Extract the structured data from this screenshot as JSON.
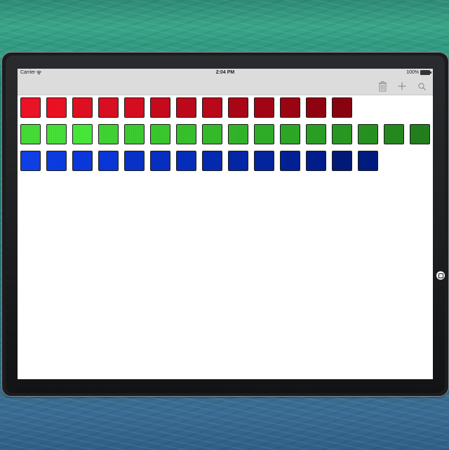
{
  "status_bar": {
    "carrier": "Carrier",
    "wifi_icon": "wifi-icon",
    "time": "2:04 PM",
    "battery": "100%",
    "battery_icon": "battery-icon"
  },
  "toolbar": {
    "buttons": [
      {
        "name": "trash-button",
        "icon": "trash-icon"
      },
      {
        "name": "add-button",
        "icon": "plus-icon"
      },
      {
        "name": "search-button",
        "icon": "search-icon"
      }
    ],
    "icon_color": "#8e8e93"
  },
  "colors": {
    "bar_background": "#dcdcdc",
    "screen_background": "#ffffff",
    "tile_border": "#1c1c1c"
  },
  "tile_rows": [
    {
      "name": "red",
      "colors": [
        "#ee1226",
        "#ec1123",
        "#e01021",
        "#d91022",
        "#d50e20",
        "#c60b1c",
        "#bc0a1b",
        "#b9091a",
        "#a90716",
        "#a20515",
        "#9b0513",
        "#8f0410",
        "#88030f"
      ]
    },
    {
      "name": "green",
      "colors": [
        "#46dc37",
        "#46e038",
        "#48e83a",
        "#40d334",
        "#3ccb31",
        "#3ac82f",
        "#37c12d",
        "#35bb2c",
        "#33b42a",
        "#30ad28",
        "#2ea826",
        "#2b9f25",
        "#299823",
        "#279221",
        "#25891f",
        "#237f1d"
      ]
    },
    {
      "name": "blue",
      "colors": [
        "#0f40e6",
        "#0c3ce0",
        "#0a38dc",
        "#0937d8",
        "#0832c8",
        "#072fc2",
        "#062dbb",
        "#052ab0",
        "#0427a6",
        "#03259e",
        "#022196",
        "#021e8c",
        "#011a78",
        "#011b80"
      ]
    }
  ]
}
